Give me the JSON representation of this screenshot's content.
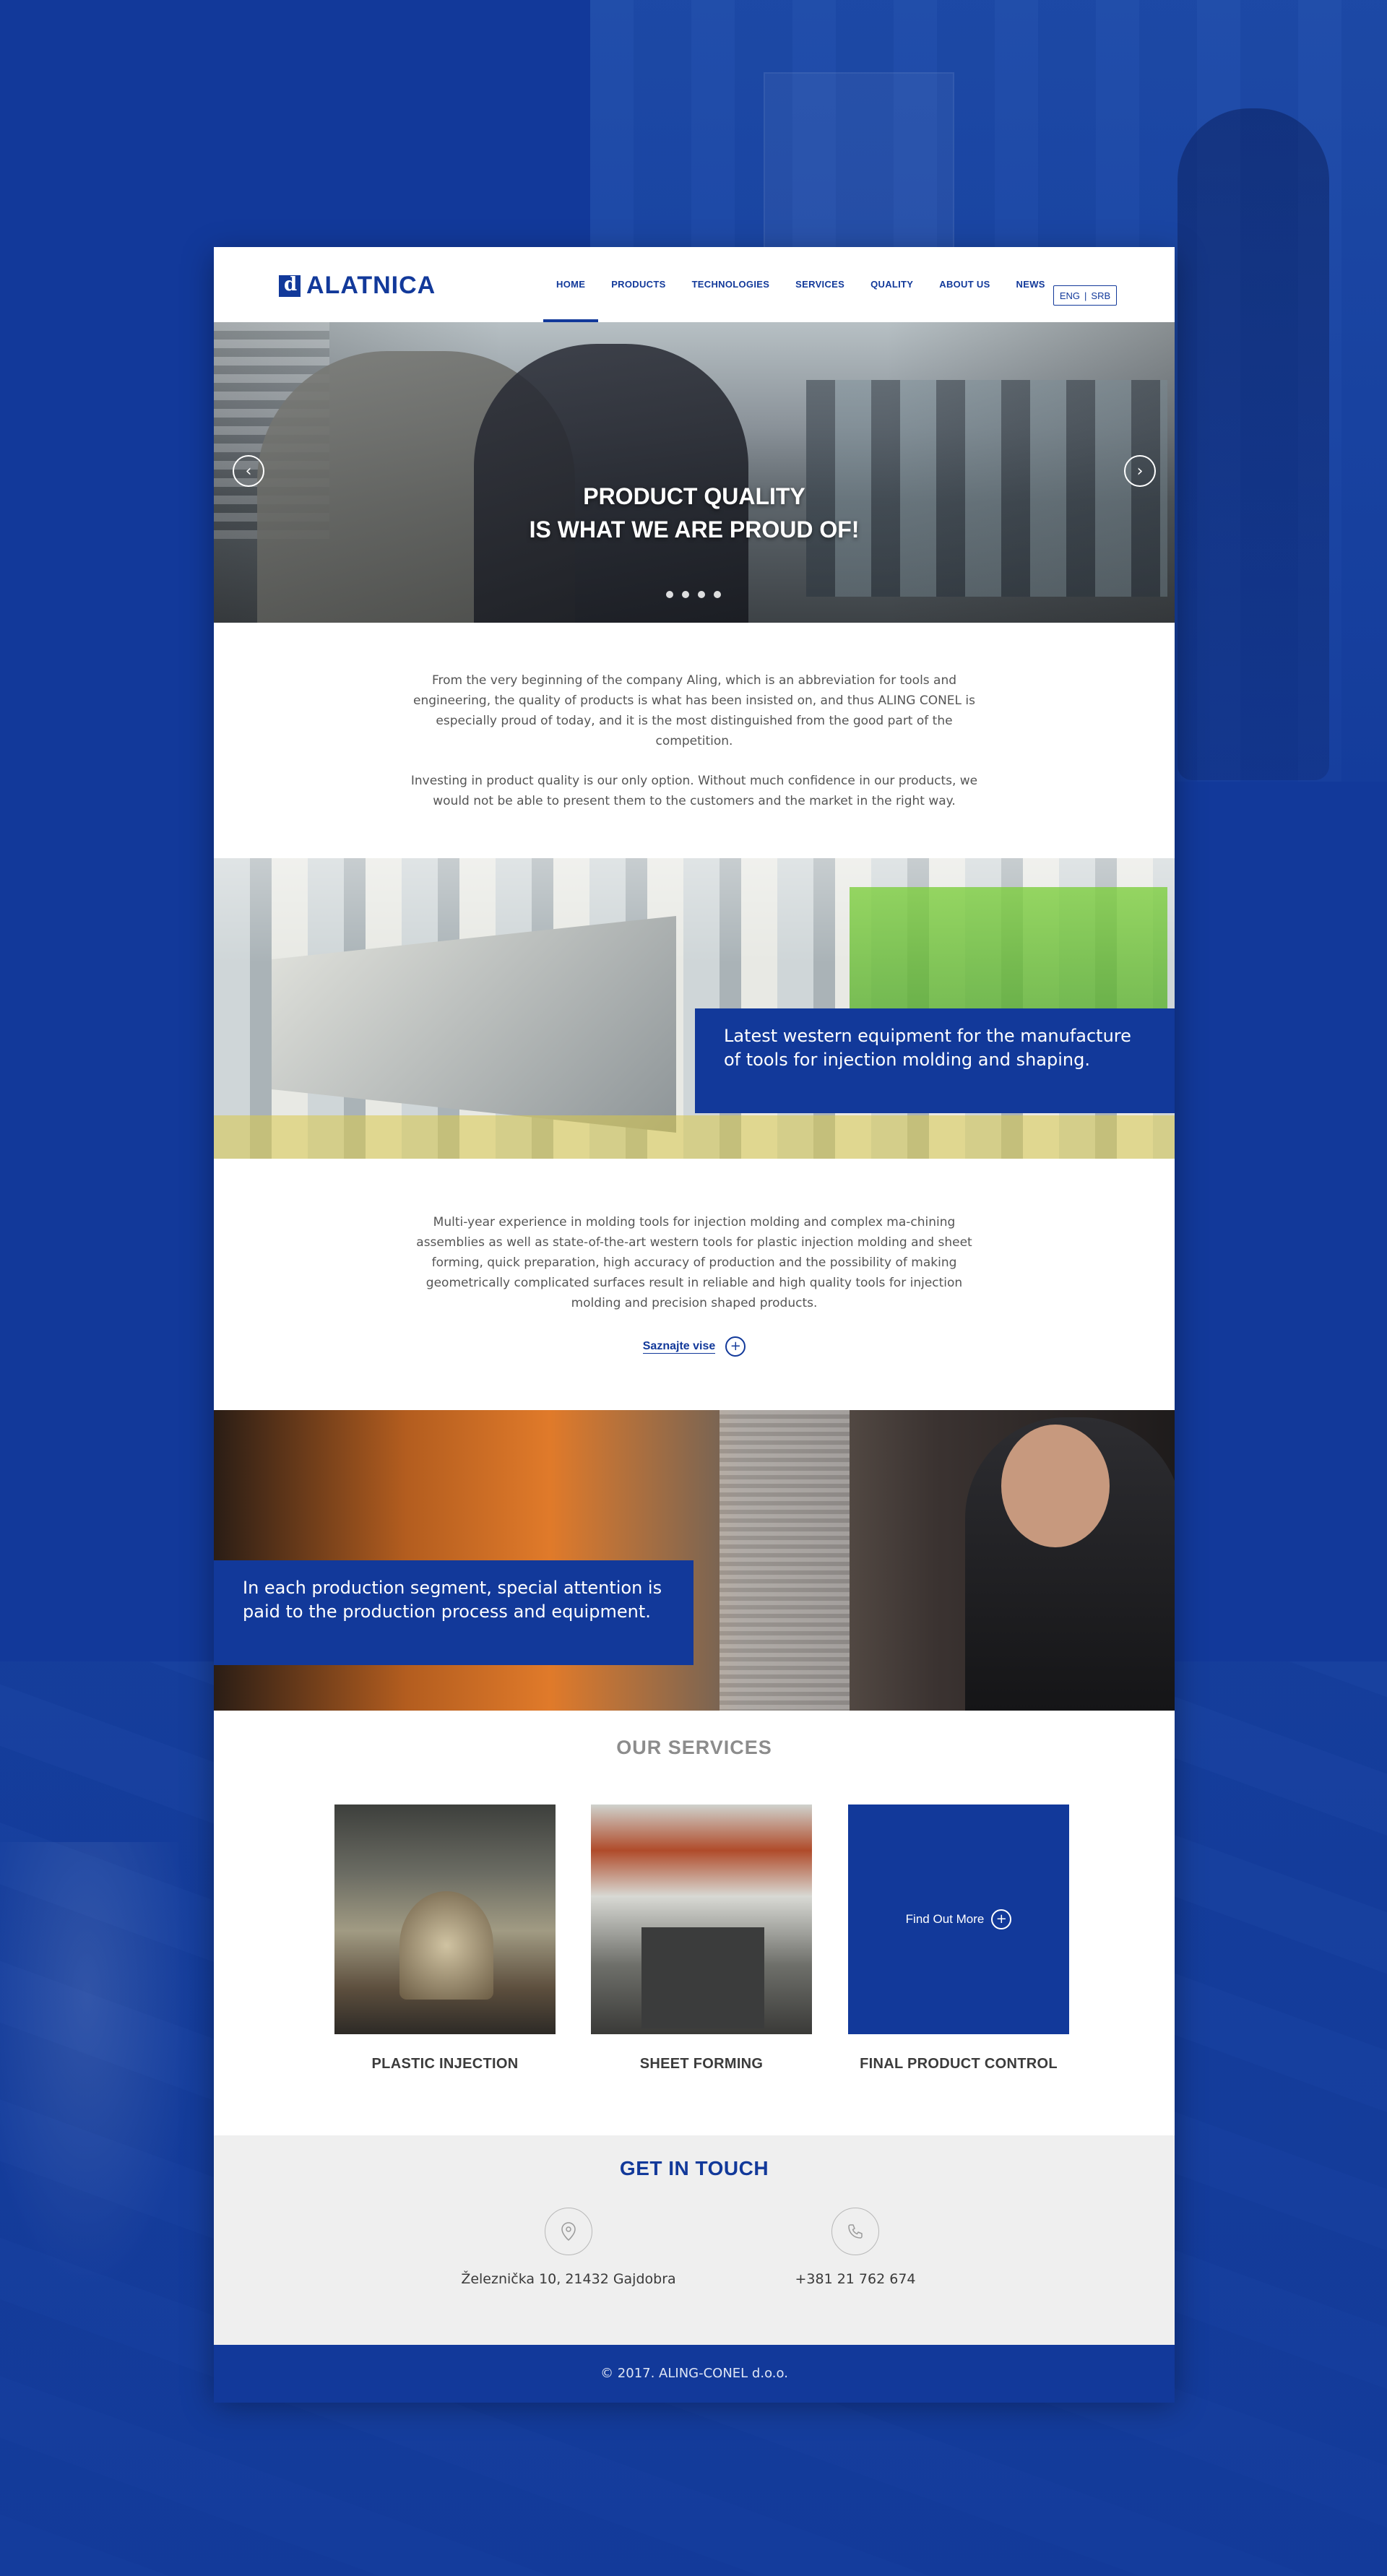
{
  "header": {
    "logo_text": "ALATNICA",
    "menu": [
      {
        "label": "HOME",
        "active": true
      },
      {
        "label": "PRODUCTS"
      },
      {
        "label": "TECHNOLOGIES"
      },
      {
        "label": "SERVICES"
      },
      {
        "label": "QUALITY"
      },
      {
        "label": "ABOUT US"
      },
      {
        "label": "NEWS"
      }
    ],
    "lang": {
      "current": "ENG",
      "separator": "|",
      "other": "SRB"
    }
  },
  "hero": {
    "title_line1": "PRODUCT QUALITY",
    "title_line2": "IS WHAT WE ARE PROUD OF!",
    "prev_icon": "chevron-left-icon",
    "next_icon": "chevron-right-icon",
    "slide_count": 4,
    "active_slide": 1
  },
  "intro": {
    "paragraph1": "From the very beginning of the company Aling, which is an abbreviation for tools and engineering, the quality of products is what has been insisted on, and thus ALING CONEL is especially proud of today, and it is the most distinguished from the good part of the competition.",
    "paragraph2": "Investing in product quality is our only option. Without much confidence in our products, we would not be able to present them to the customers and the market in the right way."
  },
  "equipment": {
    "caption": "Latest western equipment for the manufacture of tools for injection molding and shaping."
  },
  "experience": {
    "paragraph": "Multi-year experience in molding tools for injection molding and complex ma-chining assemblies as well as state-of-the-art western tools for plastic injection molding and sheet forming, quick preparation, high accuracy of production and the possibility of making geometrically complicated surfaces result in reliable and high quality tools for injection molding and precision shaped products.",
    "link_label": "Saznajte vise",
    "link_icon": "plus-circle-icon"
  },
  "segment": {
    "caption": "In each production segment, special attention is paid to the production process and equipment."
  },
  "services": {
    "title": "OUR SERVICES",
    "items": [
      {
        "label": "PLASTIC INJECTION"
      },
      {
        "label": "SHEET FORMING"
      },
      {
        "label": "FINAL PRODUCT CONTROL",
        "overlay": "Find Out More"
      }
    ]
  },
  "contact": {
    "title": "GET IN TOUCH",
    "address": "Železnička 10, 21432 Gajdobra",
    "address_icon": "map-pin-icon",
    "phone": "+381 21 762 674",
    "phone_icon": "phone-icon"
  },
  "footer": {
    "copyright": "© 2017. ALING-CONEL d.o.o."
  },
  "colors": {
    "brand_blue": "#12399a",
    "text_gray": "#555555",
    "contact_bg": "#efefef"
  }
}
